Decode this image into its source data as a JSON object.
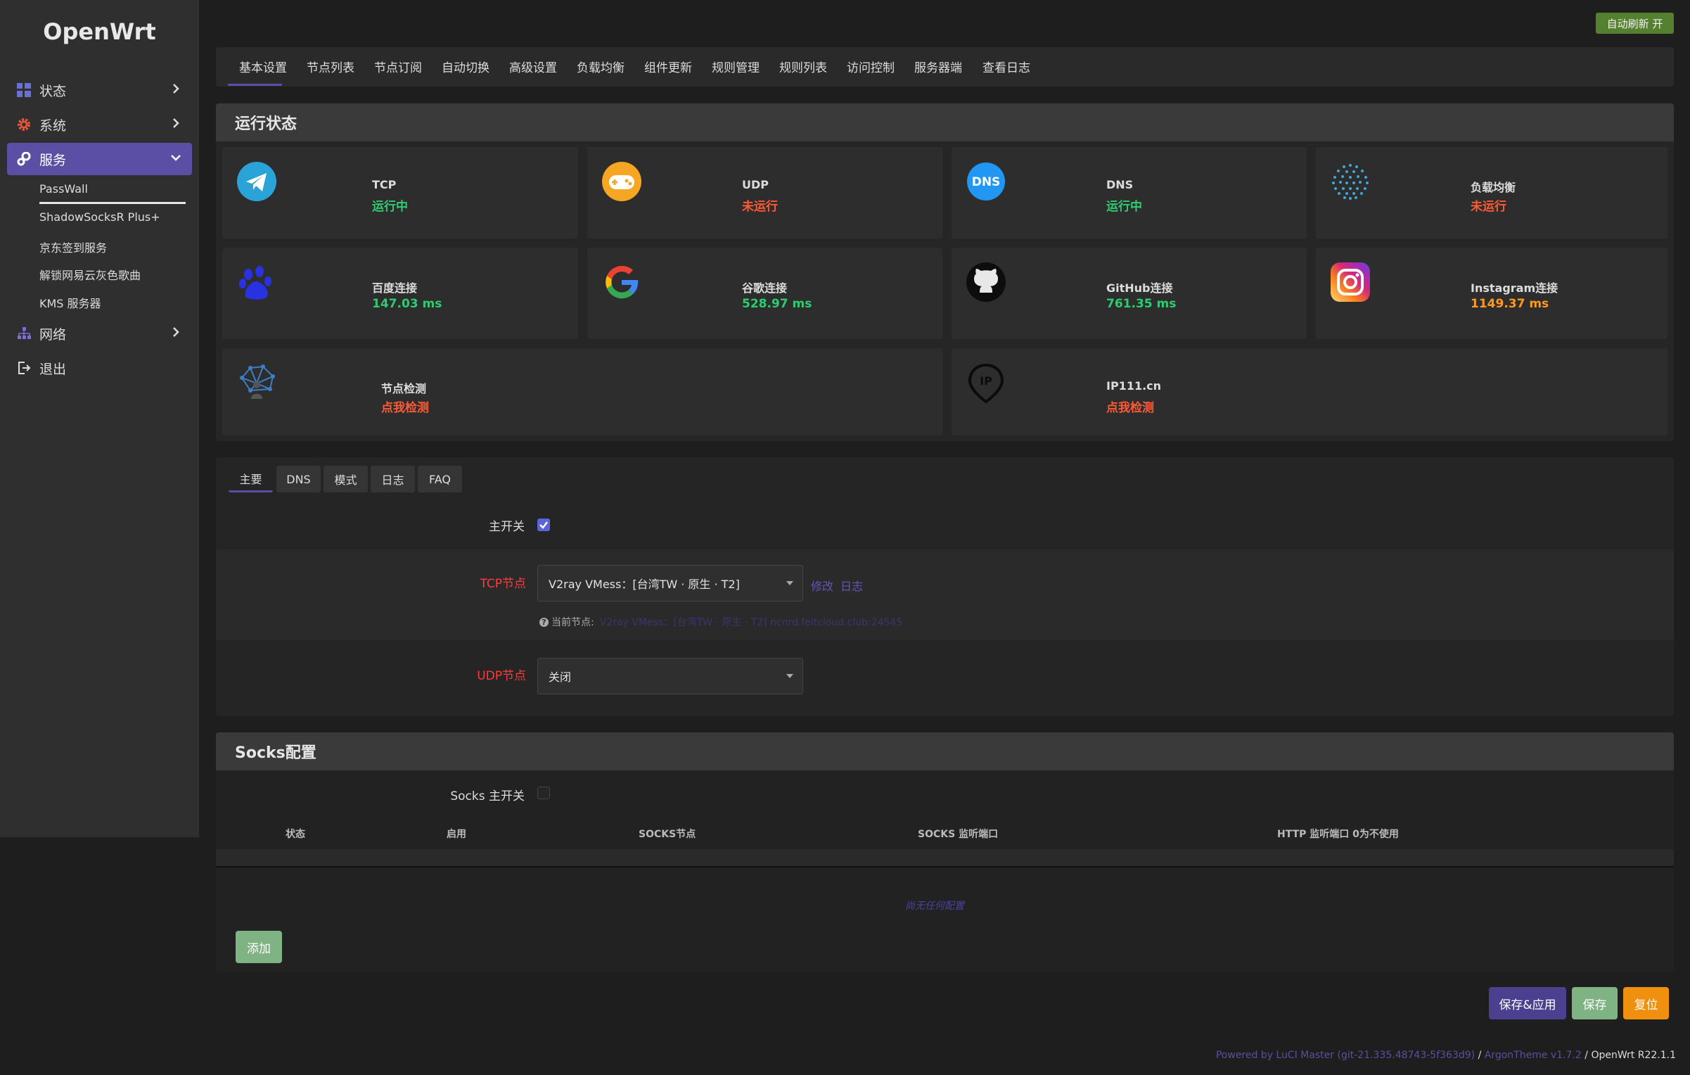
{
  "brand": "OpenWrt",
  "sidebar": {
    "items": [
      {
        "label": "状态",
        "icon": "dashboard-icon"
      },
      {
        "label": "系统",
        "icon": "gear-icon"
      },
      {
        "label": "服务",
        "icon": "services-icon"
      },
      {
        "label": "网络",
        "icon": "network-icon"
      },
      {
        "label": "退出",
        "icon": "logout-icon"
      }
    ],
    "sub_items": [
      "PassWall",
      "ShadowSocksR Plus+",
      "京东签到服务",
      "解锁网易云灰色歌曲",
      "KMS 服务器"
    ]
  },
  "header": {
    "auto_refresh": "自动刷新 开"
  },
  "tabs": [
    "基本设置",
    "节点列表",
    "节点订阅",
    "自动切换",
    "高级设置",
    "负载均衡",
    "组件更新",
    "规则管理",
    "规则列表",
    "访问控制",
    "服务器端",
    "查看日志"
  ],
  "status": {
    "title": "运行状态",
    "cards": [
      {
        "title": "TCP",
        "value": "运行中",
        "icon": "telegram-icon"
      },
      {
        "title": "UDP",
        "value": "未运行",
        "icon": "gamepad-icon"
      },
      {
        "title": "DNS",
        "value": "运行中",
        "icon": "dns-icon",
        "badge": "DNS"
      },
      {
        "title": "负载均衡",
        "value": "未运行",
        "icon": "globe-dots-icon"
      },
      {
        "title": "百度连接",
        "value": "147.03 ms",
        "icon": "baidu-paw-icon"
      },
      {
        "title": "谷歌连接",
        "value": "528.97 ms",
        "icon": "google-icon"
      },
      {
        "title": "GitHub连接",
        "value": "761.35 ms",
        "icon": "github-icon"
      },
      {
        "title": "Instagram连接",
        "value": "1149.37 ms",
        "icon": "instagram-icon"
      },
      {
        "title": "节点检测",
        "value": "点我检测",
        "icon": "network-node-icon"
      },
      {
        "title": "IP111.cn",
        "value": "点我检测",
        "icon": "ip-pin-icon",
        "badge": "IP"
      }
    ]
  },
  "subtabs": [
    "主要",
    "DNS",
    "模式",
    "日志",
    "FAQ"
  ],
  "form": {
    "main_switch_label": "主开关",
    "tcp_label": "TCP节点",
    "tcp_value": "V2ray VMess：[台湾TW · 原生 · T2]",
    "edit_link": "修改",
    "log_link": "日志",
    "current_node_label": "当前节点:",
    "current_node_value": "V2ray VMess：[台湾TW · 原生 · T2] ncnrd.feitcloud.club:24545",
    "udp_label": "UDP节点",
    "udp_value": "关闭"
  },
  "socks": {
    "title": "Socks配置",
    "switch_label": "Socks 主开关",
    "columns": [
      "状态",
      "启用",
      "SOCKS节点",
      "SOCKS 监听端口",
      "HTTP 监听端口 0为不使用"
    ],
    "empty": "尚无任何配置",
    "add_button": "添加"
  },
  "actions": {
    "save_apply": "保存&应用",
    "save": "保存",
    "reset": "复位"
  },
  "footer": {
    "powered": "Powered by LuCI Master (git-21.335.48743-5f363d9)",
    "sep1": " / ",
    "theme": "ArgonTheme v1.7.2",
    "sep2": " / ",
    "version": "OpenWrt R22.1.1"
  },
  "colors": {
    "accent": "#5b4fa5",
    "running": "#2ecc71",
    "stopped": "#ff5a36",
    "latency_high": "#ff9a1f",
    "refresh": "#55802f"
  }
}
